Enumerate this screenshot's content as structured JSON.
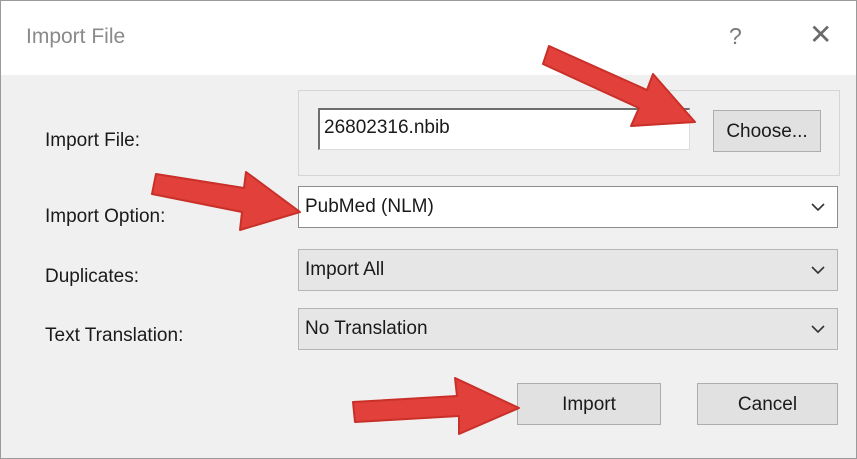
{
  "window": {
    "title": "Import File",
    "help_glyph": "?",
    "close_glyph": "✕"
  },
  "form": {
    "import_file_label": "Import File:",
    "import_file_value": "26802316.nbib",
    "choose_label": "Choose...",
    "import_option_label": "Import Option:",
    "import_option_value": "PubMed (NLM)",
    "duplicates_label": "Duplicates:",
    "duplicates_value": "Import All",
    "text_translation_label": "Text Translation:",
    "text_translation_value": "No Translation"
  },
  "buttons": {
    "import_label": "Import",
    "cancel_label": "Cancel"
  },
  "annotations": {
    "arrow_color": "#e2403a",
    "arrow_targets": [
      "choose-button",
      "import-option-select",
      "import-button"
    ]
  }
}
